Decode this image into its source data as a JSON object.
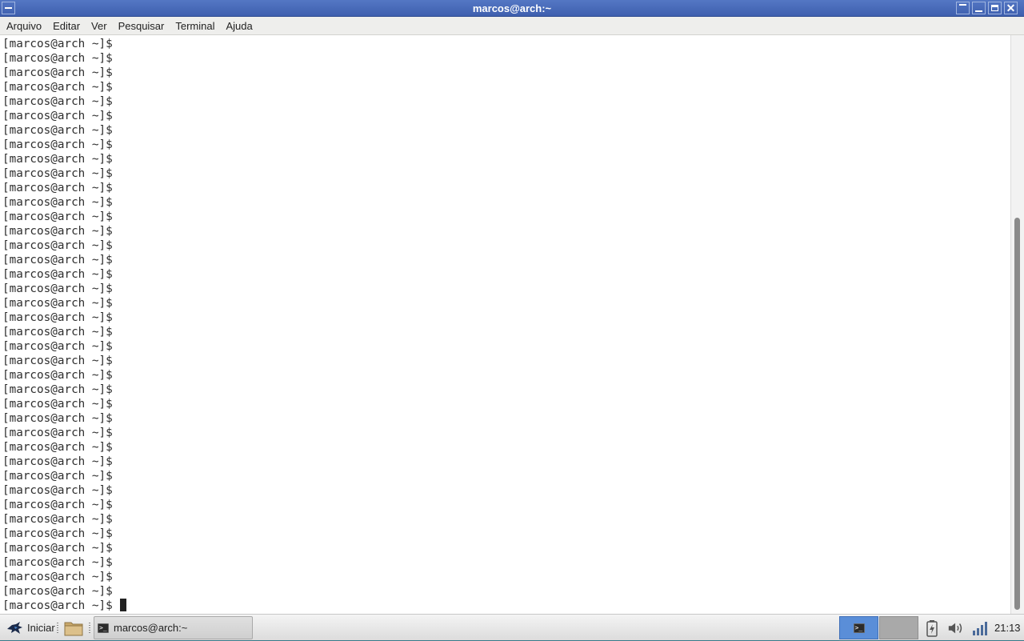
{
  "window": {
    "title": "marcos@arch:~"
  },
  "menubar": {
    "items": [
      "Arquivo",
      "Editar",
      "Ver",
      "Pesquisar",
      "Terminal",
      "Ajuda"
    ]
  },
  "terminal": {
    "prompt": "[marcos@arch ~]$",
    "line_count": 40
  },
  "taskbar": {
    "start_label": "Iniciar",
    "task_label": "marcos@arch:~",
    "clock": "21:13"
  },
  "colors": {
    "titlebar": "#4a6dbf",
    "active_workspace": "#5a8ed8"
  },
  "icons": {
    "start": "mouse-mascot-icon",
    "folder": "folder-icon",
    "terminal": "terminal-icon",
    "battery": "battery-charging-icon",
    "volume": "volume-icon",
    "network": "network-signal-icon"
  }
}
